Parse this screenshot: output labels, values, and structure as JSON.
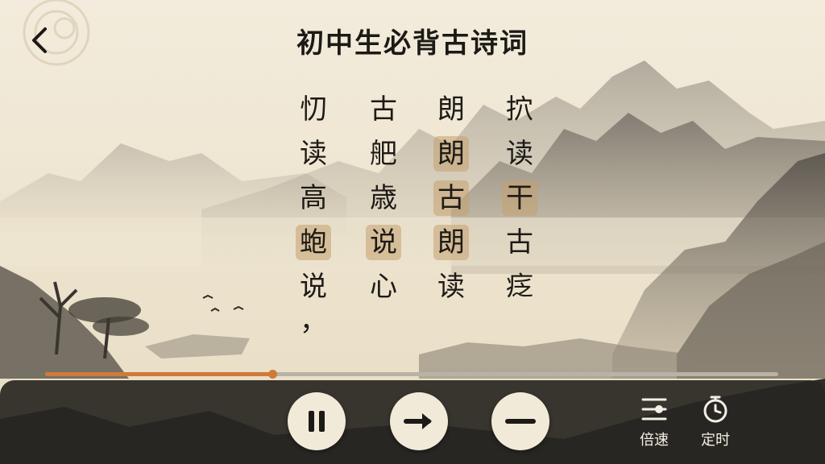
{
  "header": {
    "title": "初中生必背古诗词",
    "back_icon": "chevron-left-icon"
  },
  "poem": {
    "columns": [
      {
        "chars": [
          "忉",
          "读",
          "高",
          "蚫",
          "说",
          "，"
        ],
        "highlighted": [
          3
        ]
      },
      {
        "chars": [
          "古",
          "舥",
          "歳",
          "说",
          "心"
        ],
        "highlighted": [
          3
        ]
      },
      {
        "chars": [
          "朗",
          "朗",
          "古",
          "朗",
          "读"
        ],
        "highlighted": [
          1,
          2,
          3
        ]
      },
      {
        "chars": [
          "㧒",
          "读",
          "干",
          "古",
          "疺"
        ],
        "highlighted": [
          2
        ]
      }
    ]
  },
  "playback": {
    "progress": 0.31
  },
  "controls": {
    "pause_icon": "pause-icon",
    "next_icon": "arrow-right-icon",
    "minus_icon": "minus-icon"
  },
  "tools": {
    "speed_label": "倍速",
    "speed_icon": "sliders-icon",
    "timer_label": "定时",
    "timer_icon": "stopwatch-icon"
  },
  "colors": {
    "accent": "#d07a3a",
    "highlight": "#c4a070",
    "paper": "#efe6d2",
    "bar": "#282622"
  }
}
